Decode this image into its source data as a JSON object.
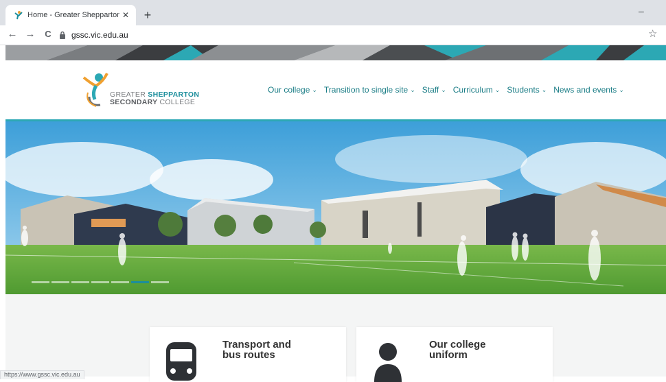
{
  "browser": {
    "tab_title": "Home - Greater Shepparton Seco",
    "tab_close": "✕",
    "new_tab": "+",
    "minimize": "–",
    "back": "←",
    "forward": "→",
    "reload": "C",
    "url": "gssc.vic.edu.au",
    "bookmark": "☆",
    "status_url": "https://www.gssc.vic.edu.au"
  },
  "site": {
    "logo_line1_a": "GREATER ",
    "logo_line1_b": "SHEPPARTON",
    "logo_line2_a": "SECONDARY ",
    "logo_line2_b": "COLLEGE",
    "nav": [
      {
        "label": "Our college"
      },
      {
        "label": "Transition to single site"
      },
      {
        "label": "Staff"
      },
      {
        "label": "Curriculum"
      },
      {
        "label": "Students"
      },
      {
        "label": "News and events"
      }
    ],
    "chevron": "⌄",
    "slides": {
      "count": 7,
      "active_index": 5
    },
    "cards": [
      {
        "title": "Transport and\nbus routes",
        "icon": "bus-icon"
      },
      {
        "title": "Our college\nuniform",
        "icon": "person-icon"
      }
    ]
  },
  "colors": {
    "teal": "#1c8e9c",
    "accent_orange": "#f0a030",
    "grass": "#5fa83a",
    "sky": "#4aa7dd"
  }
}
